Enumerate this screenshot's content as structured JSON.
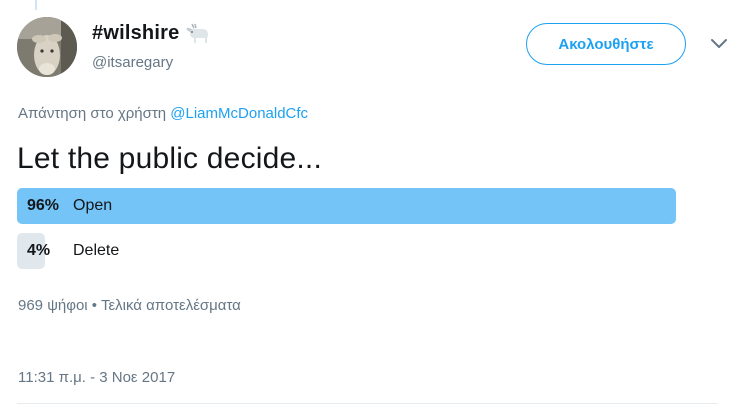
{
  "tweet": {
    "author": {
      "display_name": "#wilshire",
      "handle": "@itsaregary",
      "emoji_icon": "goat-icon"
    },
    "follow_label": "Ακολουθήστε",
    "reply_prefix": "Απάντηση στο χρήστη ",
    "reply_mention": "@LiamMcDonaldCfc",
    "text": "Let the public decide...",
    "poll": {
      "options": [
        {
          "percent_label": "96%",
          "label": "Open",
          "share": 0.96
        },
        {
          "percent_label": "4%",
          "label": "Delete",
          "share": 0.04
        }
      ],
      "summary": "969 ψήφοι • Τελικά αποτελέσματα"
    },
    "timestamp": "11:31 π.μ. - 3 Νοε 2017"
  },
  "colors": {
    "accent": "#1da1f2",
    "winning_bar": "#74c4f7",
    "losing_bar": "#e1e8ed",
    "secondary_text": "#657786"
  }
}
